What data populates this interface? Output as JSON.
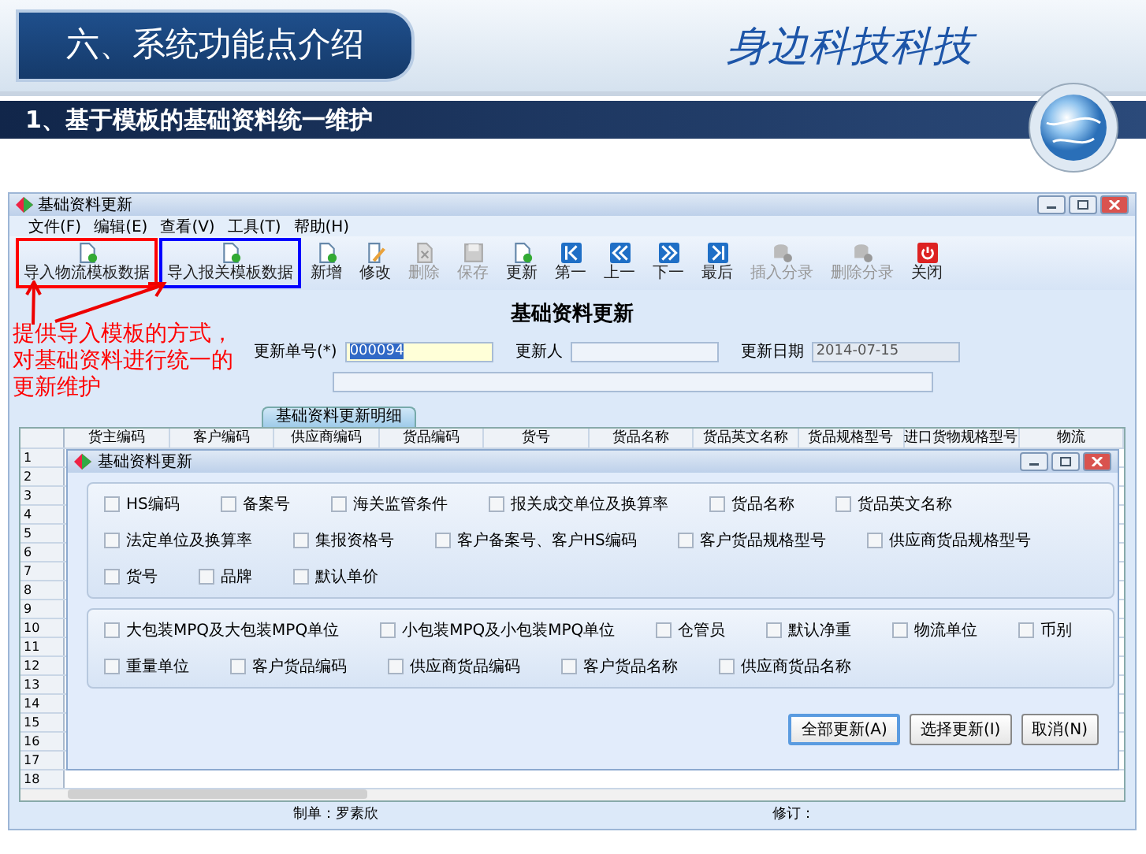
{
  "slide": {
    "title": "六、系统功能点介绍",
    "brand": "身边科技科技",
    "subtitle": "1、基于模板的基础资料统一维护"
  },
  "window": {
    "title": "基础资料更新",
    "menu": [
      "文件(F)",
      "编辑(E)",
      "查看(V)",
      "工具(T)",
      "帮助(H)"
    ],
    "toolbar": [
      {
        "label": "导入物流模板数据",
        "kind": "add",
        "disabled": false,
        "color": "#ff0000"
      },
      {
        "label": "导入报关模板数据",
        "kind": "add",
        "disabled": false,
        "color": "#0000ff"
      },
      {
        "label": "新增",
        "kind": "add",
        "disabled": false
      },
      {
        "label": "修改",
        "kind": "edit",
        "disabled": false
      },
      {
        "label": "删除",
        "kind": "delete",
        "disabled": true
      },
      {
        "label": "保存",
        "kind": "save",
        "disabled": true
      },
      {
        "label": "更新",
        "kind": "add",
        "disabled": false
      },
      {
        "label": "第一",
        "kind": "first",
        "disabled": false
      },
      {
        "label": "上一",
        "kind": "prev",
        "disabled": false
      },
      {
        "label": "下一",
        "kind": "next",
        "disabled": false
      },
      {
        "label": "最后",
        "kind": "last",
        "disabled": false
      },
      {
        "label": "插入分录",
        "kind": "db",
        "disabled": true
      },
      {
        "label": "删除分录",
        "kind": "db",
        "disabled": true
      },
      {
        "label": "关闭",
        "kind": "power",
        "disabled": false
      }
    ],
    "form": {
      "heading": "基础资料更新",
      "fields": [
        {
          "label": "更新单号(*)",
          "value": "000094",
          "kind": "highlighted"
        },
        {
          "label": "更新人",
          "kind": "normal"
        },
        {
          "label": "更新日期",
          "value": "2014-07-15",
          "kind": "readonly"
        }
      ]
    },
    "tab": {
      "label": "基础资料更新明细"
    },
    "grid": {
      "columns": [
        "货主编码",
        "客户编码",
        "供应商编码",
        "货品编码",
        "货号",
        "货品名称",
        "货品英文名称",
        "货品规格型号",
        "进口货物规格型号",
        "物流"
      ],
      "row_numbers": [
        "1",
        "2",
        "3",
        "4",
        "5",
        "6",
        "7",
        "8",
        "9",
        "10",
        "11",
        "12",
        "13",
        "14",
        "15",
        "16",
        "17",
        "18"
      ]
    },
    "status_bar": [
      "制单：罗素欣",
      "修订："
    ]
  },
  "dialog": {
    "title": "基础资料更新",
    "groups": [
      {
        "options": [
          {
            "label": "HS编码",
            "checked": false
          },
          {
            "label": "备案号",
            "checked": false
          },
          {
            "label": "海关监管条件",
            "checked": false
          },
          {
            "label": "报关成交单位及换算率",
            "checked": false
          },
          {
            "label": "货品名称",
            "checked": false
          },
          {
            "label": "货品英文名称",
            "checked": false
          },
          {
            "label": "法定单位及换算率",
            "checked": false
          },
          {
            "label": "集报资格号",
            "checked": false
          },
          {
            "label": "客户备案号、客户HS编码",
            "checked": false
          },
          {
            "label": "客户货品规格型号",
            "checked": false
          },
          {
            "label": "供应商货品规格型号",
            "checked": false
          },
          {
            "label": "货号",
            "checked": false
          },
          {
            "label": "品牌",
            "checked": false
          },
          {
            "label": "默认单价",
            "checked": false
          }
        ]
      },
      {
        "options": [
          {
            "label": "大包装MPQ及大包装MPQ单位",
            "checked": false
          },
          {
            "label": "小包装MPQ及小包装MPQ单位",
            "checked": false
          },
          {
            "label": "仓管员",
            "checked": false
          },
          {
            "label": "默认净重",
            "checked": false
          },
          {
            "label": "物流单位",
            "checked": false
          },
          {
            "label": "币别",
            "checked": false
          },
          {
            "label": "重量单位",
            "checked": false
          },
          {
            "label": "客户货品编码",
            "checked": false
          },
          {
            "label": "供应商货品编码",
            "checked": false
          },
          {
            "label": "客户货品名称",
            "checked": false
          },
          {
            "label": "供应商货品名称",
            "checked": false
          }
        ]
      }
    ],
    "buttons": [
      {
        "label": "全部更新(A)",
        "default": true
      },
      {
        "label": "选择更新(I)",
        "default": false
      },
      {
        "label": "取消(N)",
        "default": false
      }
    ]
  },
  "annotation": {
    "text": "提供导入模板的方式，对基础资料进行统一的更新维护"
  }
}
